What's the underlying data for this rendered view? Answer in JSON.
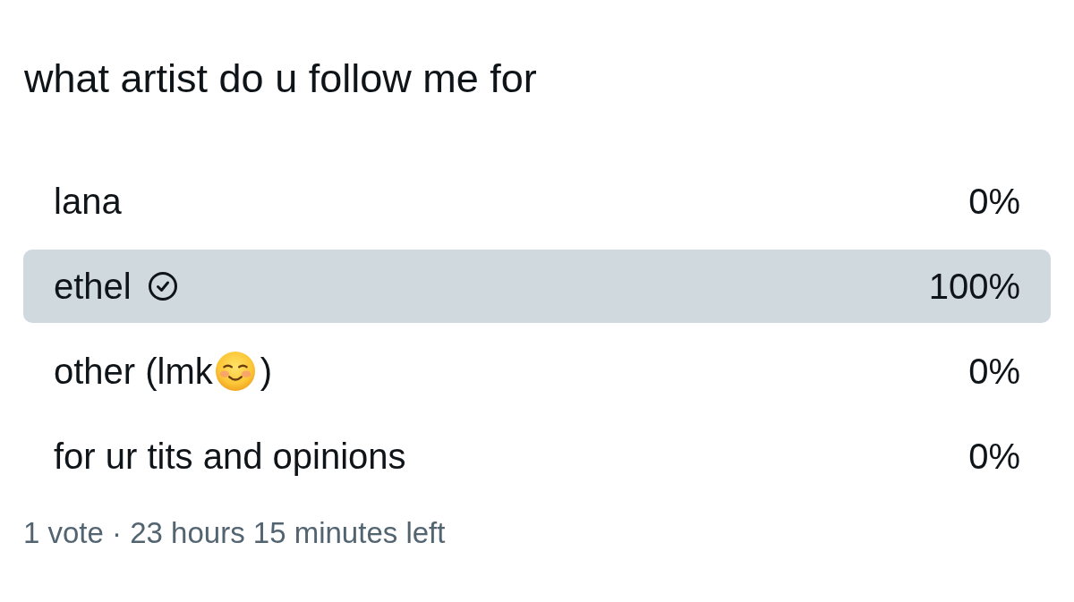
{
  "poll": {
    "question": "what artist do u follow me for",
    "options": [
      {
        "kind": "text",
        "label": "lana",
        "percent": "0%",
        "leading": false,
        "voted": false
      },
      {
        "kind": "text",
        "label": "ethel",
        "percent": "100%",
        "leading": true,
        "voted": true
      },
      {
        "kind": "emoji",
        "label": "other (lmk",
        "label_end": ")",
        "percent": "0%",
        "leading": false,
        "voted": false
      },
      {
        "kind": "text",
        "label": "for ur tits and opinions",
        "percent": "0%",
        "leading": false,
        "voted": false
      }
    ],
    "footer": "1 vote · 23 hours 15 minutes left"
  }
}
